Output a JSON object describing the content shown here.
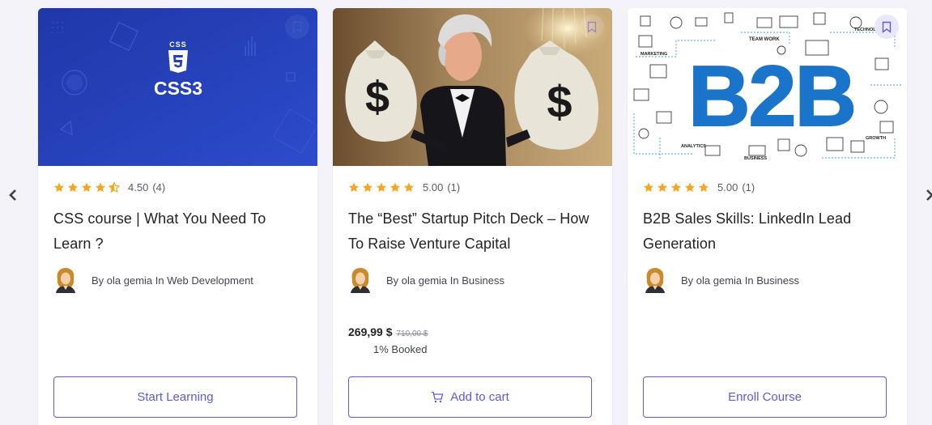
{
  "nav": {
    "prev_icon": "chevron-left-icon",
    "next_icon": "chevron-right-icon"
  },
  "colors": {
    "accent": "#5f5ad6",
    "star": "#f5a623",
    "css_bg": "#2340b8"
  },
  "courses": [
    {
      "thumbnail": {
        "badge_text": "CSS",
        "logo_text": "CSS3",
        "logo_icon": "css3-shield-icon"
      },
      "rating": {
        "value": "4.50",
        "count": "(4)",
        "stars": 4.5
      },
      "title": "CSS course | What You Need To Learn ?",
      "author": "By ola gemia In Web Development",
      "cta": "Start Learning"
    },
    {
      "thumbnail": {
        "icon": "money-bags-photo"
      },
      "rating": {
        "value": "5.00",
        "count": "(1)",
        "stars": 5
      },
      "title": "The “Best” Startup Pitch Deck – How To Raise Venture Capital",
      "author": "By ola gemia In Business",
      "price": "269,99 $",
      "old_price": "710,00 $",
      "booked": "1% Booked",
      "cta": "Add to cart",
      "cta_icon": "cart-icon"
    },
    {
      "thumbnail": {
        "headline": "B2B",
        "labels": [
          "TEAM WORK",
          "TECHNOLOGY",
          "MARKETING",
          "ANALYTICS",
          "BUSINESS",
          "GROWTH"
        ]
      },
      "rating": {
        "value": "5.00",
        "count": "(1)",
        "stars": 5
      },
      "title": "B2B Sales Skills: LinkedIn Lead Generation",
      "author": "By ola gemia In Business",
      "cta": "Enroll Course"
    }
  ]
}
